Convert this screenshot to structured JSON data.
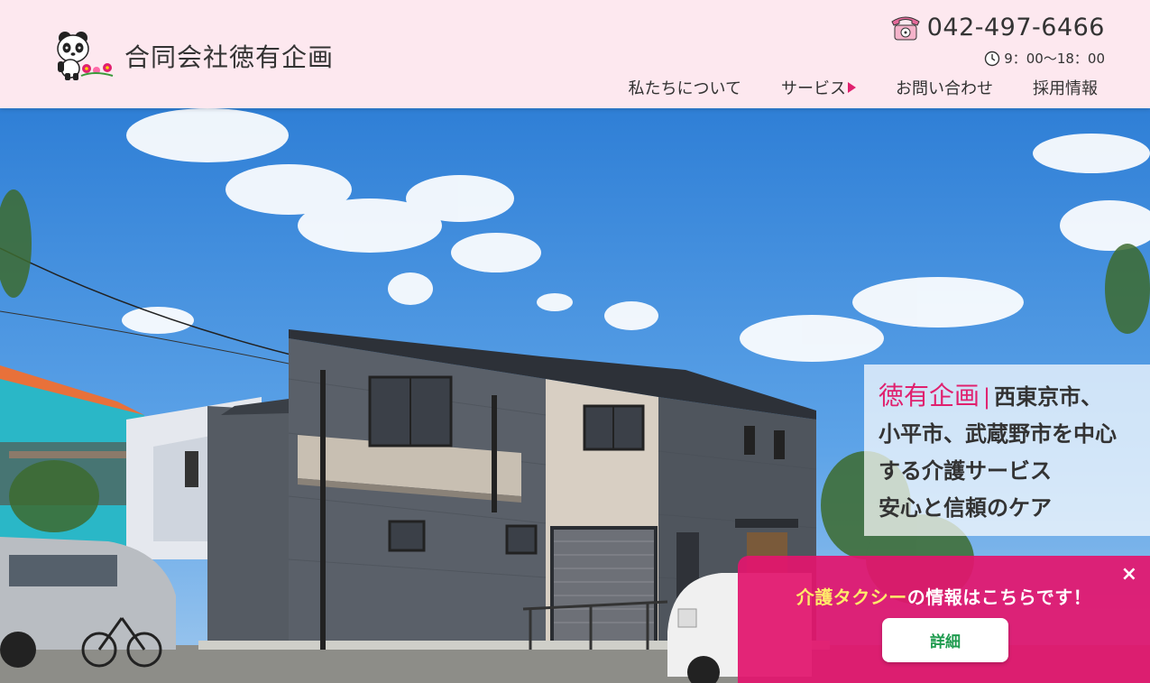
{
  "header": {
    "brand": "合同会社徳有企画",
    "phone": "042-497-6466",
    "hours": "9：00～18：00",
    "nav": [
      {
        "label": "私たちについて"
      },
      {
        "label": "サービス"
      },
      {
        "label": "お問い合わせ"
      },
      {
        "label": "採用情報"
      }
    ]
  },
  "hero": {
    "caption": {
      "brand": "徳有企画",
      "separator": "|",
      "line1": "西東京市、",
      "line2": "小平市、武蔵野市を中心",
      "line3": "する介護サービス",
      "line4": "安心と信頼のケア"
    }
  },
  "taxi_banner": {
    "highlight": "介護タクシー",
    "text": "の情報はこちらです！",
    "button_label": "詳細",
    "close_label": "×"
  },
  "colors": {
    "header_bg": "#fde8ef",
    "accent_pink": "#e0206e",
    "button_text_green": "#1e9b4e"
  }
}
